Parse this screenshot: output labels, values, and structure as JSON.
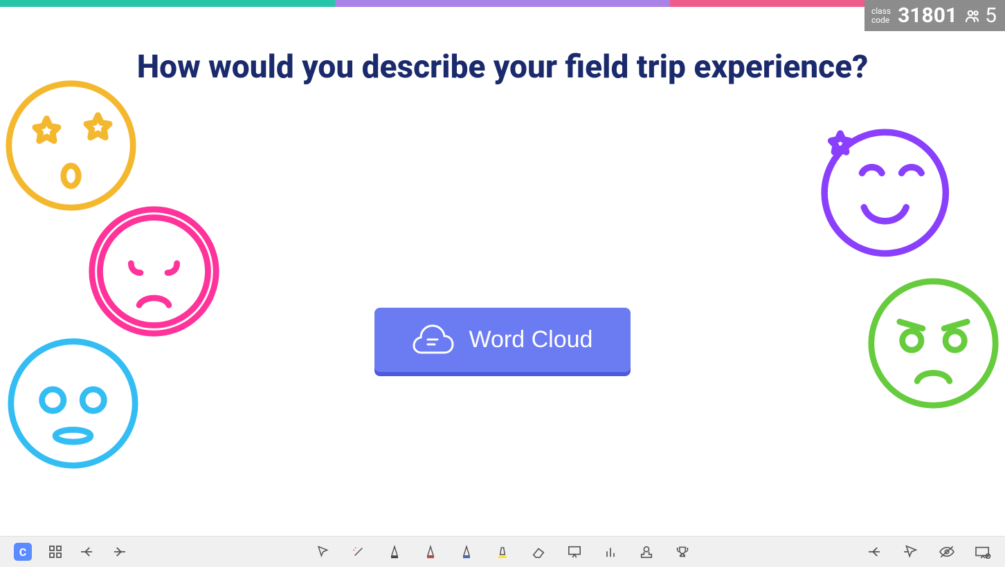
{
  "stripes": [
    "#28c4a7",
    "#a882e6",
    "#ef5b8b"
  ],
  "class_badge": {
    "label1": "class",
    "label2": "code",
    "code": "31801",
    "count": "5"
  },
  "question": "How would you describe your field trip experience?",
  "button": {
    "label": "Word Cloud"
  },
  "faces": {
    "yellow": "star-eyes-surprised",
    "pink": "sad",
    "blue": "neutral-wide",
    "purple": "happy-star",
    "green": "angry"
  },
  "toolbar": {
    "logo": "C",
    "left": [
      "grid-icon",
      "arrow-left-icon",
      "arrow-right-icon"
    ],
    "center": [
      "cursor-icon",
      "wand-icon",
      "pen-black-icon",
      "pen-red-icon",
      "pen-blue-icon",
      "highlighter-icon",
      "eraser-icon",
      "whiteboard-icon",
      "poll-icon",
      "stamp-icon",
      "trophy-icon"
    ],
    "right": [
      "arrow-left-icon",
      "cursor-go-icon",
      "eye-off-icon",
      "projector-off-icon"
    ]
  }
}
